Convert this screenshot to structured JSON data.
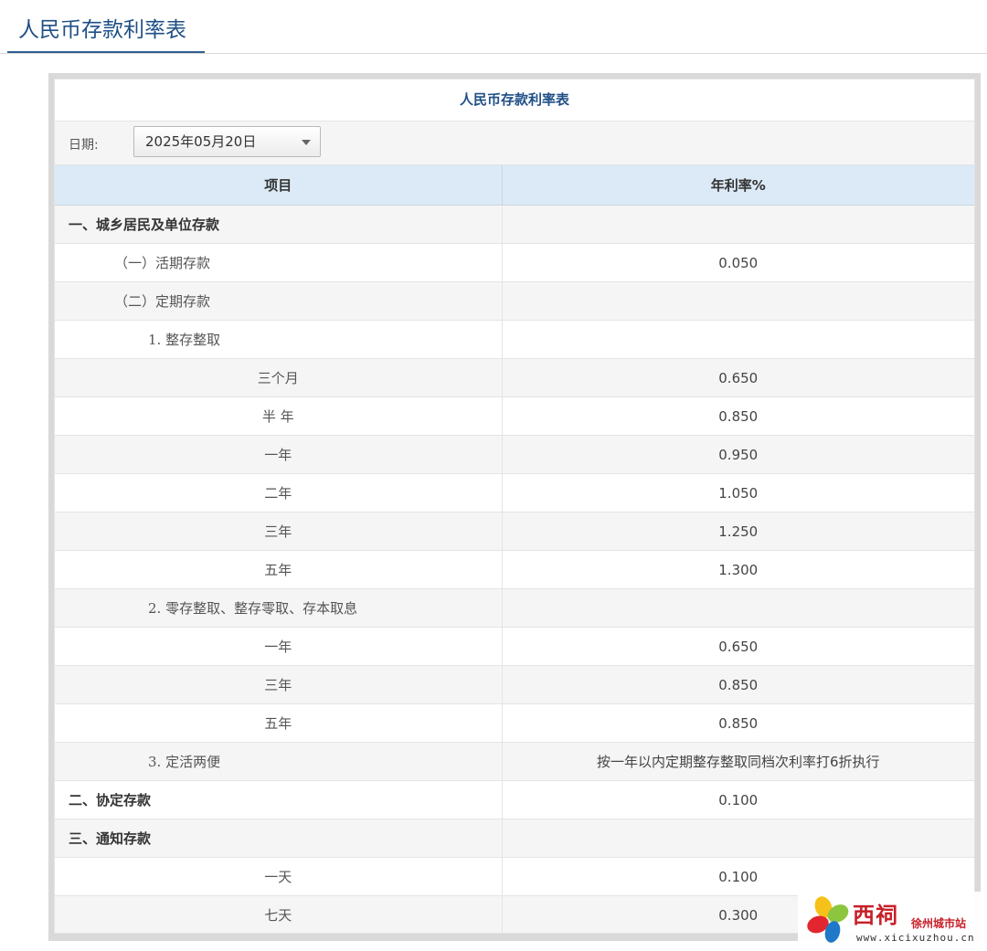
{
  "header": {
    "title": "人民币存款利率表"
  },
  "table": {
    "title": "人民币存款利率表",
    "date_label": "日期:",
    "date_value": "2025年05月20日",
    "columns": [
      "项目",
      "年利率%"
    ],
    "rows": [
      {
        "label": "一、城乡居民及单位存款",
        "value": "",
        "level": 0
      },
      {
        "label": "（一）活期存款",
        "value": "0.050",
        "level": 1
      },
      {
        "label": "（二）定期存款",
        "value": "",
        "level": 1
      },
      {
        "label": "1. 整存整取",
        "value": "",
        "level": 2
      },
      {
        "label": "三个月",
        "value": "0.650",
        "level": 3
      },
      {
        "label": "半 年",
        "value": "0.850",
        "level": 3
      },
      {
        "label": "一年",
        "value": "0.950",
        "level": 3
      },
      {
        "label": "二年",
        "value": "1.050",
        "level": 3
      },
      {
        "label": "三年",
        "value": "1.250",
        "level": 3
      },
      {
        "label": "五年",
        "value": "1.300",
        "level": 3
      },
      {
        "label": "2. 零存整取、整存零取、存本取息",
        "value": "",
        "level": 2
      },
      {
        "label": "一年",
        "value": "0.650",
        "level": 3
      },
      {
        "label": "三年",
        "value": "0.850",
        "level": 3
      },
      {
        "label": "五年",
        "value": "0.850",
        "level": 3
      },
      {
        "label": "3. 定活两便",
        "value": "按一年以内定期整存整取同档次利率打6折执行",
        "level": 2
      },
      {
        "label": "二、协定存款",
        "value": "0.100",
        "level": 0
      },
      {
        "label": "三、通知存款",
        "value": "",
        "level": 0
      },
      {
        "label": "一天",
        "value": "0.100",
        "level": 3
      },
      {
        "label": "七天",
        "value": "0.300",
        "level": 3
      }
    ]
  },
  "watermark": {
    "brand": "西祠",
    "city": "徐州城市站",
    "url": "www.xicixuzhou.cn"
  }
}
